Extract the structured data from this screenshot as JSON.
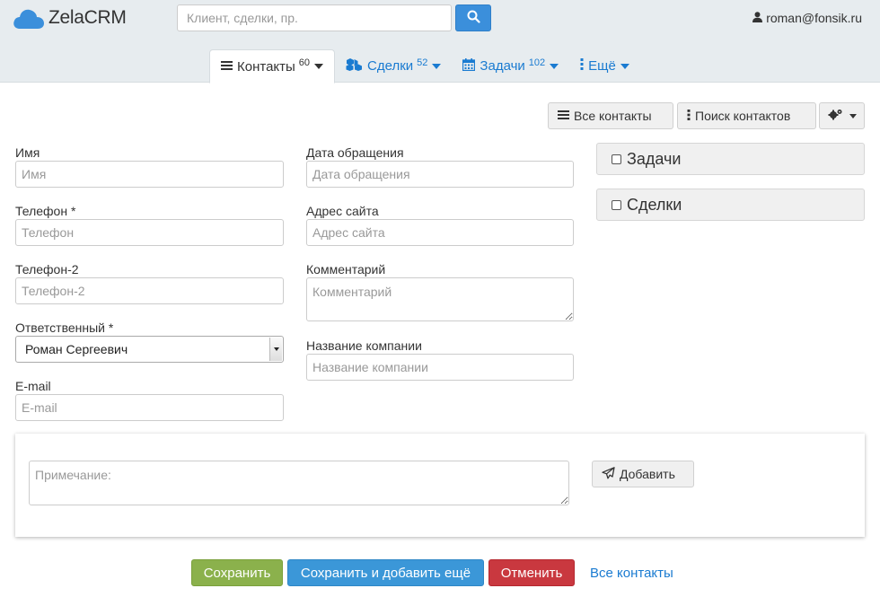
{
  "header": {
    "logo_text": "ZelaCRM",
    "search_placeholder": "Клиент, сделки, пр.",
    "user_email": "roman@fonsik.ru"
  },
  "tabs": [
    {
      "label": "Контакты",
      "count": "60",
      "icon": "list-icon",
      "active": true
    },
    {
      "label": "Сделки",
      "count": "52",
      "icon": "cubes-icon",
      "active": false
    },
    {
      "label": "Задачи",
      "count": "102",
      "icon": "calendar-icon",
      "active": false
    },
    {
      "label": "Ещё",
      "count": "",
      "icon": "vertical-ellipsis-icon",
      "active": false
    }
  ],
  "toolbar": {
    "all_contacts": "Все контакты",
    "search_contacts": "Поиск контактов"
  },
  "form": {
    "name": {
      "label": "Имя",
      "placeholder": "Имя",
      "value": ""
    },
    "phone": {
      "label": "Телефон *",
      "placeholder": "Телефон",
      "value": ""
    },
    "phone2": {
      "label": "Телефон-2",
      "placeholder": "Телефон-2",
      "value": ""
    },
    "responsible": {
      "label": "Ответственный *",
      "value": "Роман Сергеевич"
    },
    "email": {
      "label": "E-mail",
      "placeholder": "E-mail",
      "value": ""
    },
    "request_date": {
      "label": "Дата обращения",
      "placeholder": "Дата обращения",
      "value": ""
    },
    "website": {
      "label": "Адрес сайта",
      "placeholder": "Адрес сайта",
      "value": ""
    },
    "comment": {
      "label": "Комментарий",
      "placeholder": "Комментарий",
      "value": ""
    },
    "company": {
      "label": "Название компании",
      "placeholder": "Название компании",
      "value": ""
    }
  },
  "panels": {
    "tasks": "Задачи",
    "deals": "Сделки"
  },
  "note": {
    "placeholder": "Примечание:",
    "add_label": "Добавить"
  },
  "footer": {
    "save": "Сохранить",
    "save_add": "Сохранить и добавить ещё",
    "cancel": "Отменить",
    "all_contacts": "Все контакты"
  },
  "colors": {
    "header_bg": "#e7ecef",
    "link": "#1a7bd1",
    "search_btn": "#3b8fdb",
    "save": "#8bb14c",
    "save_add": "#3b97d8",
    "cancel": "#c9383f"
  }
}
